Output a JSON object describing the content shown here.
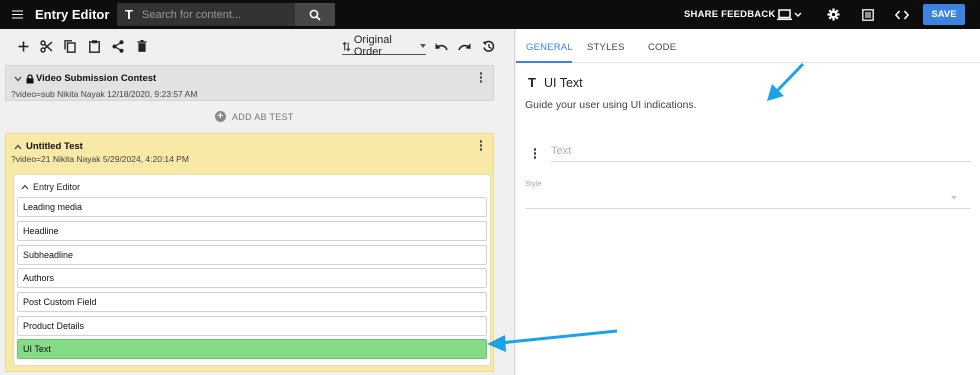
{
  "header": {
    "title": "Entry Editor",
    "search_placeholder": "Search for content...",
    "share_feedback": "SHARE FEEDBACK",
    "save_label": "SAVE"
  },
  "toolbar": {
    "sort_label": "Original Order"
  },
  "entries": [
    {
      "title": "Video Submission Contest",
      "subtitle": "?video=sub Nikita Nayak 12/18/2020, 9:23:57 AM"
    },
    {
      "title": "Untitled Test",
      "subtitle": "?video=21 Nikita Nayak 5/29/2024, 4:20:14 PM"
    }
  ],
  "add_ab_test": "ADD AB TEST",
  "editor": {
    "title": "Entry Editor",
    "fields": [
      "Leading media",
      "Headline",
      "Subheadline",
      "Authors",
      "Post Custom Field",
      "Product Details",
      "UI Text"
    ],
    "active_field": "UI Text"
  },
  "panel": {
    "tabs": [
      "GENERAL",
      "STYLES",
      "CODE"
    ],
    "active_tab": "GENERAL",
    "component_title": "UI Text",
    "description": "Guide your user using UI indications.",
    "text_placeholder": "Text",
    "style_label": "Style"
  },
  "colors": {
    "accent": "#3d84e0",
    "active_field": "#86db86",
    "test_card": "#f8e9a7",
    "arrow": "#1aa3e8"
  }
}
